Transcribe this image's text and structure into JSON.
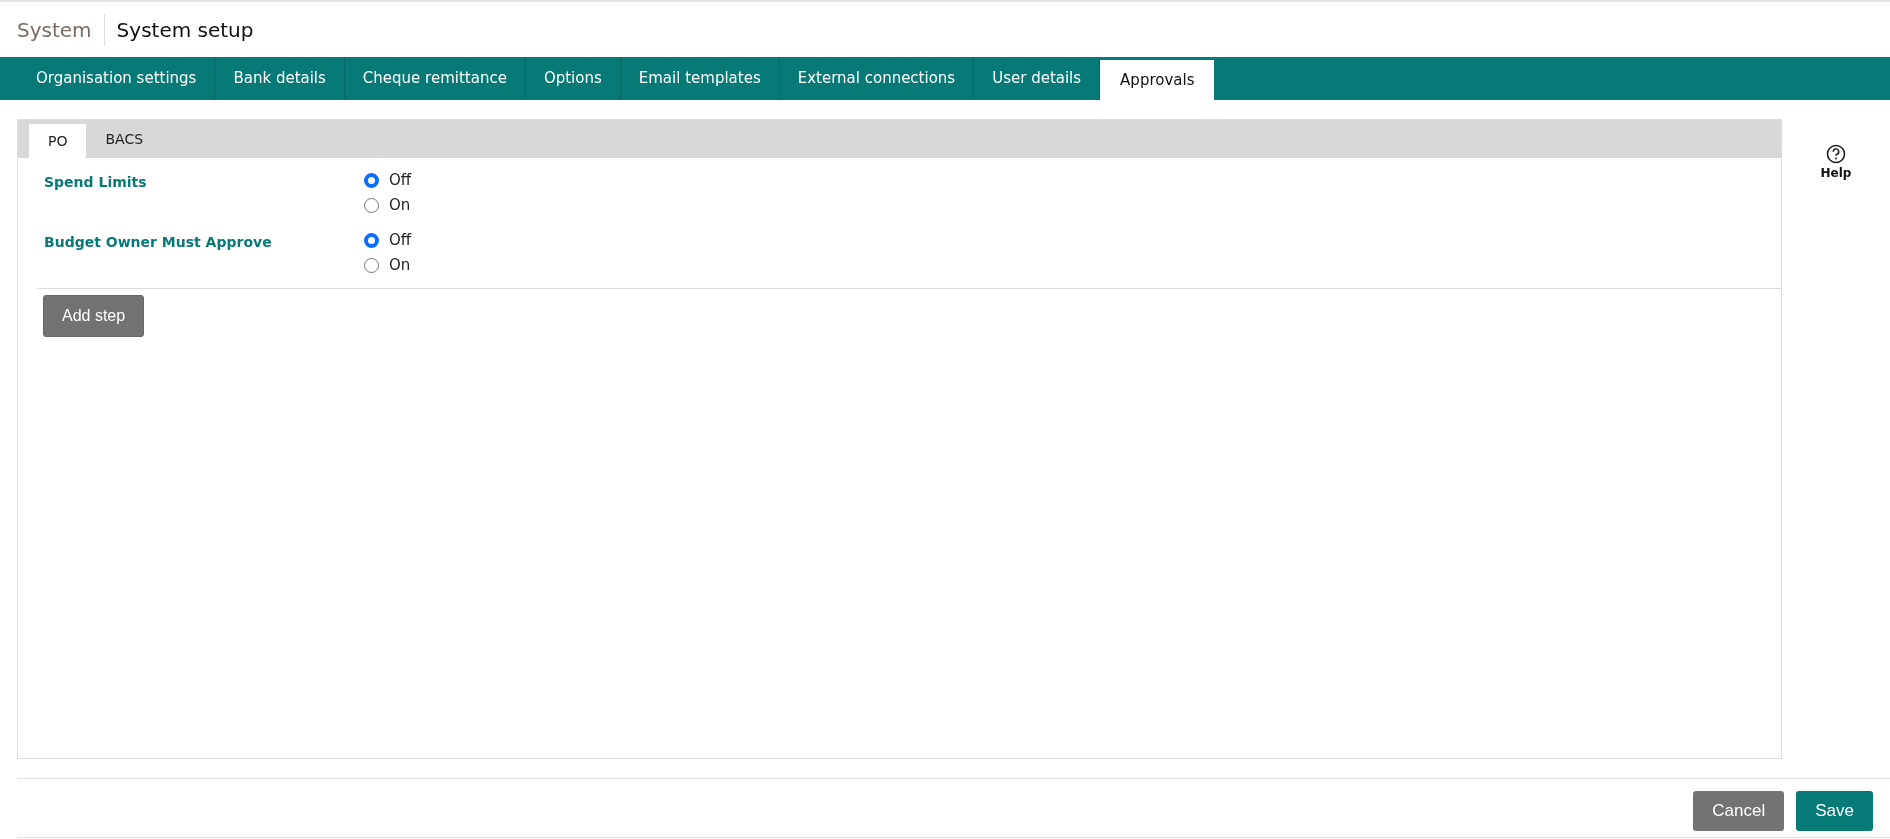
{
  "header": {
    "section": "System",
    "title": "System setup"
  },
  "tabs": [
    {
      "label": "Organisation settings",
      "selected": false
    },
    {
      "label": "Bank details",
      "selected": false
    },
    {
      "label": "Cheque remittance",
      "selected": false
    },
    {
      "label": "Options",
      "selected": false
    },
    {
      "label": "Email templates",
      "selected": false
    },
    {
      "label": "External connections",
      "selected": false
    },
    {
      "label": "User details",
      "selected": false
    },
    {
      "label": "Approvals",
      "selected": true
    }
  ],
  "subtabs": [
    {
      "label": "PO",
      "selected": true
    },
    {
      "label": "BACS",
      "selected": false
    }
  ],
  "settings": [
    {
      "label": "Spend Limits",
      "options": [
        {
          "label": "Off",
          "selected": true
        },
        {
          "label": "On",
          "selected": false
        }
      ]
    },
    {
      "label": "Budget Owner Must Approve",
      "options": [
        {
          "label": "Off",
          "selected": true
        },
        {
          "label": "On",
          "selected": false
        }
      ]
    }
  ],
  "add_button": "Add step",
  "help": "Help",
  "buttons": [
    {
      "label": "Cancel",
      "kind": "secondary"
    },
    {
      "label": "Save",
      "kind": "primary"
    }
  ]
}
